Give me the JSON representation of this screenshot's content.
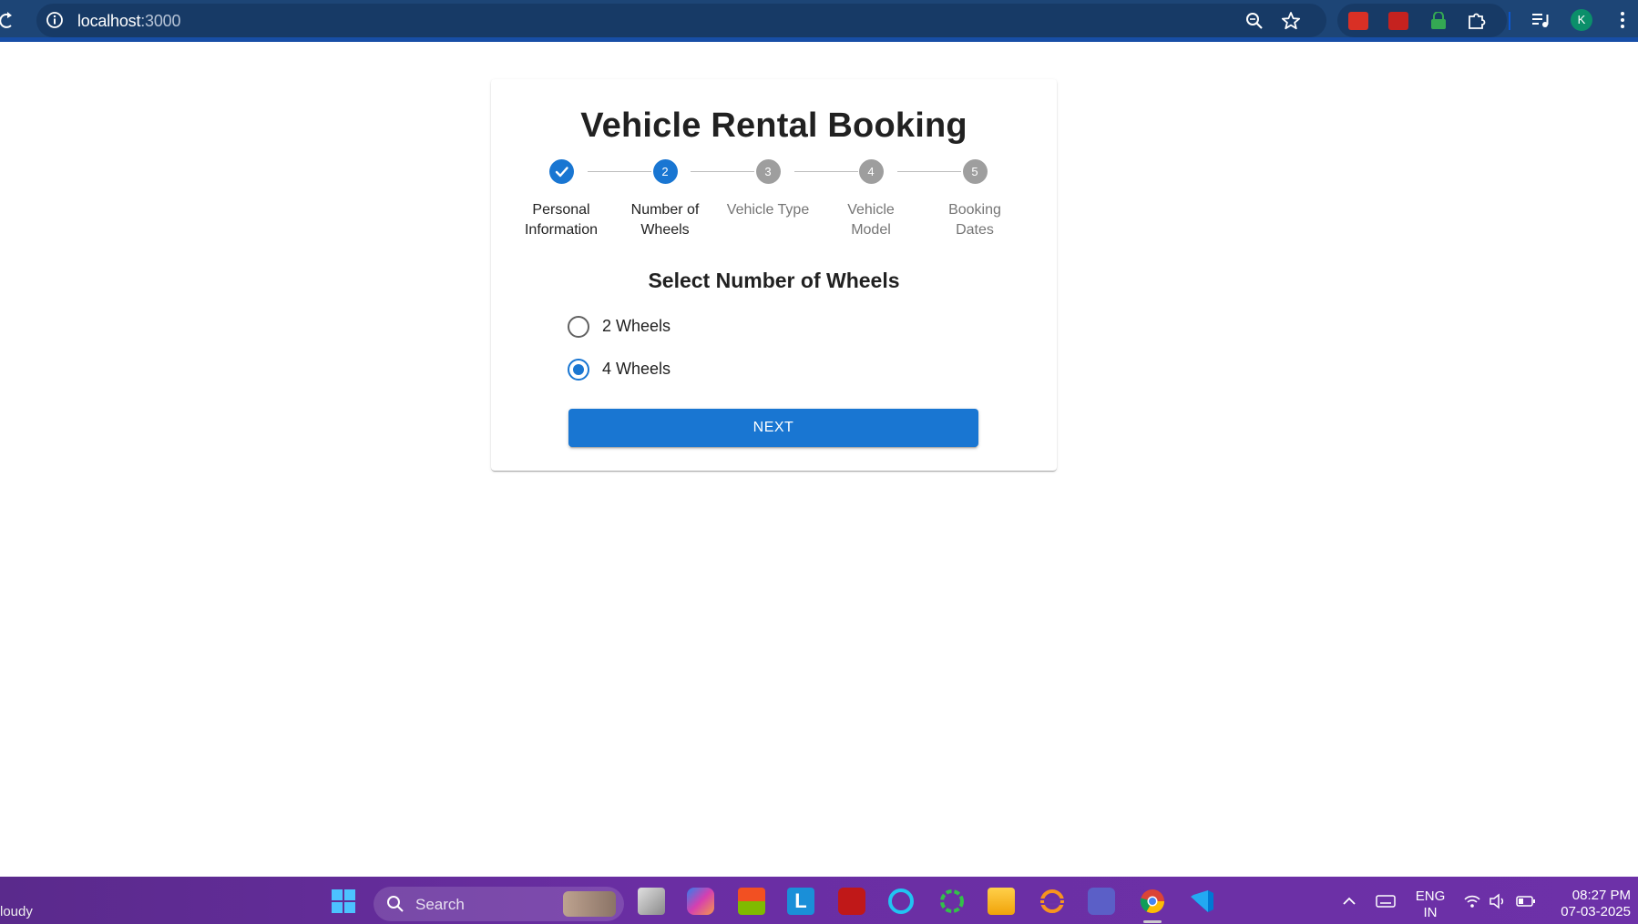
{
  "browser": {
    "url_host": "localhost",
    "url_port": ":3000",
    "profile_initial": "K",
    "icons": [
      "reload-icon",
      "site-info-icon",
      "zoom-icon",
      "bookmark-star-icon",
      "extension-icon",
      "media-icon",
      "kebab-menu-icon"
    ]
  },
  "card": {
    "title": "Vehicle Rental Booking",
    "steps": [
      {
        "number": "1",
        "label_line1": "Personal",
        "label_line2": "Information",
        "state": "completed"
      },
      {
        "number": "2",
        "label_line1": "Number of",
        "label_line2": "Wheels",
        "state": "active"
      },
      {
        "number": "3",
        "label_line1": "Vehicle Type",
        "label_line2": "",
        "state": "pending"
      },
      {
        "number": "4",
        "label_line1": "Vehicle",
        "label_line2": "Model",
        "state": "pending"
      },
      {
        "number": "5",
        "label_line1": "Booking",
        "label_line2": "Dates",
        "state": "pending"
      }
    ],
    "section_title": "Select Number of Wheels",
    "options": [
      {
        "label": "2 Wheels",
        "selected": false
      },
      {
        "label": "4 Wheels",
        "selected": true
      }
    ],
    "next_label": "NEXT"
  },
  "taskbar": {
    "weather": "loudy",
    "search_placeholder": "Search",
    "language_line1": "ENG",
    "language_line2": "IN",
    "time": "08:27 PM",
    "date": "07-03-2025"
  },
  "colors": {
    "primary": "#1976d2",
    "browser_bar": "#1d4576",
    "pending_step": "#9e9e9e"
  }
}
